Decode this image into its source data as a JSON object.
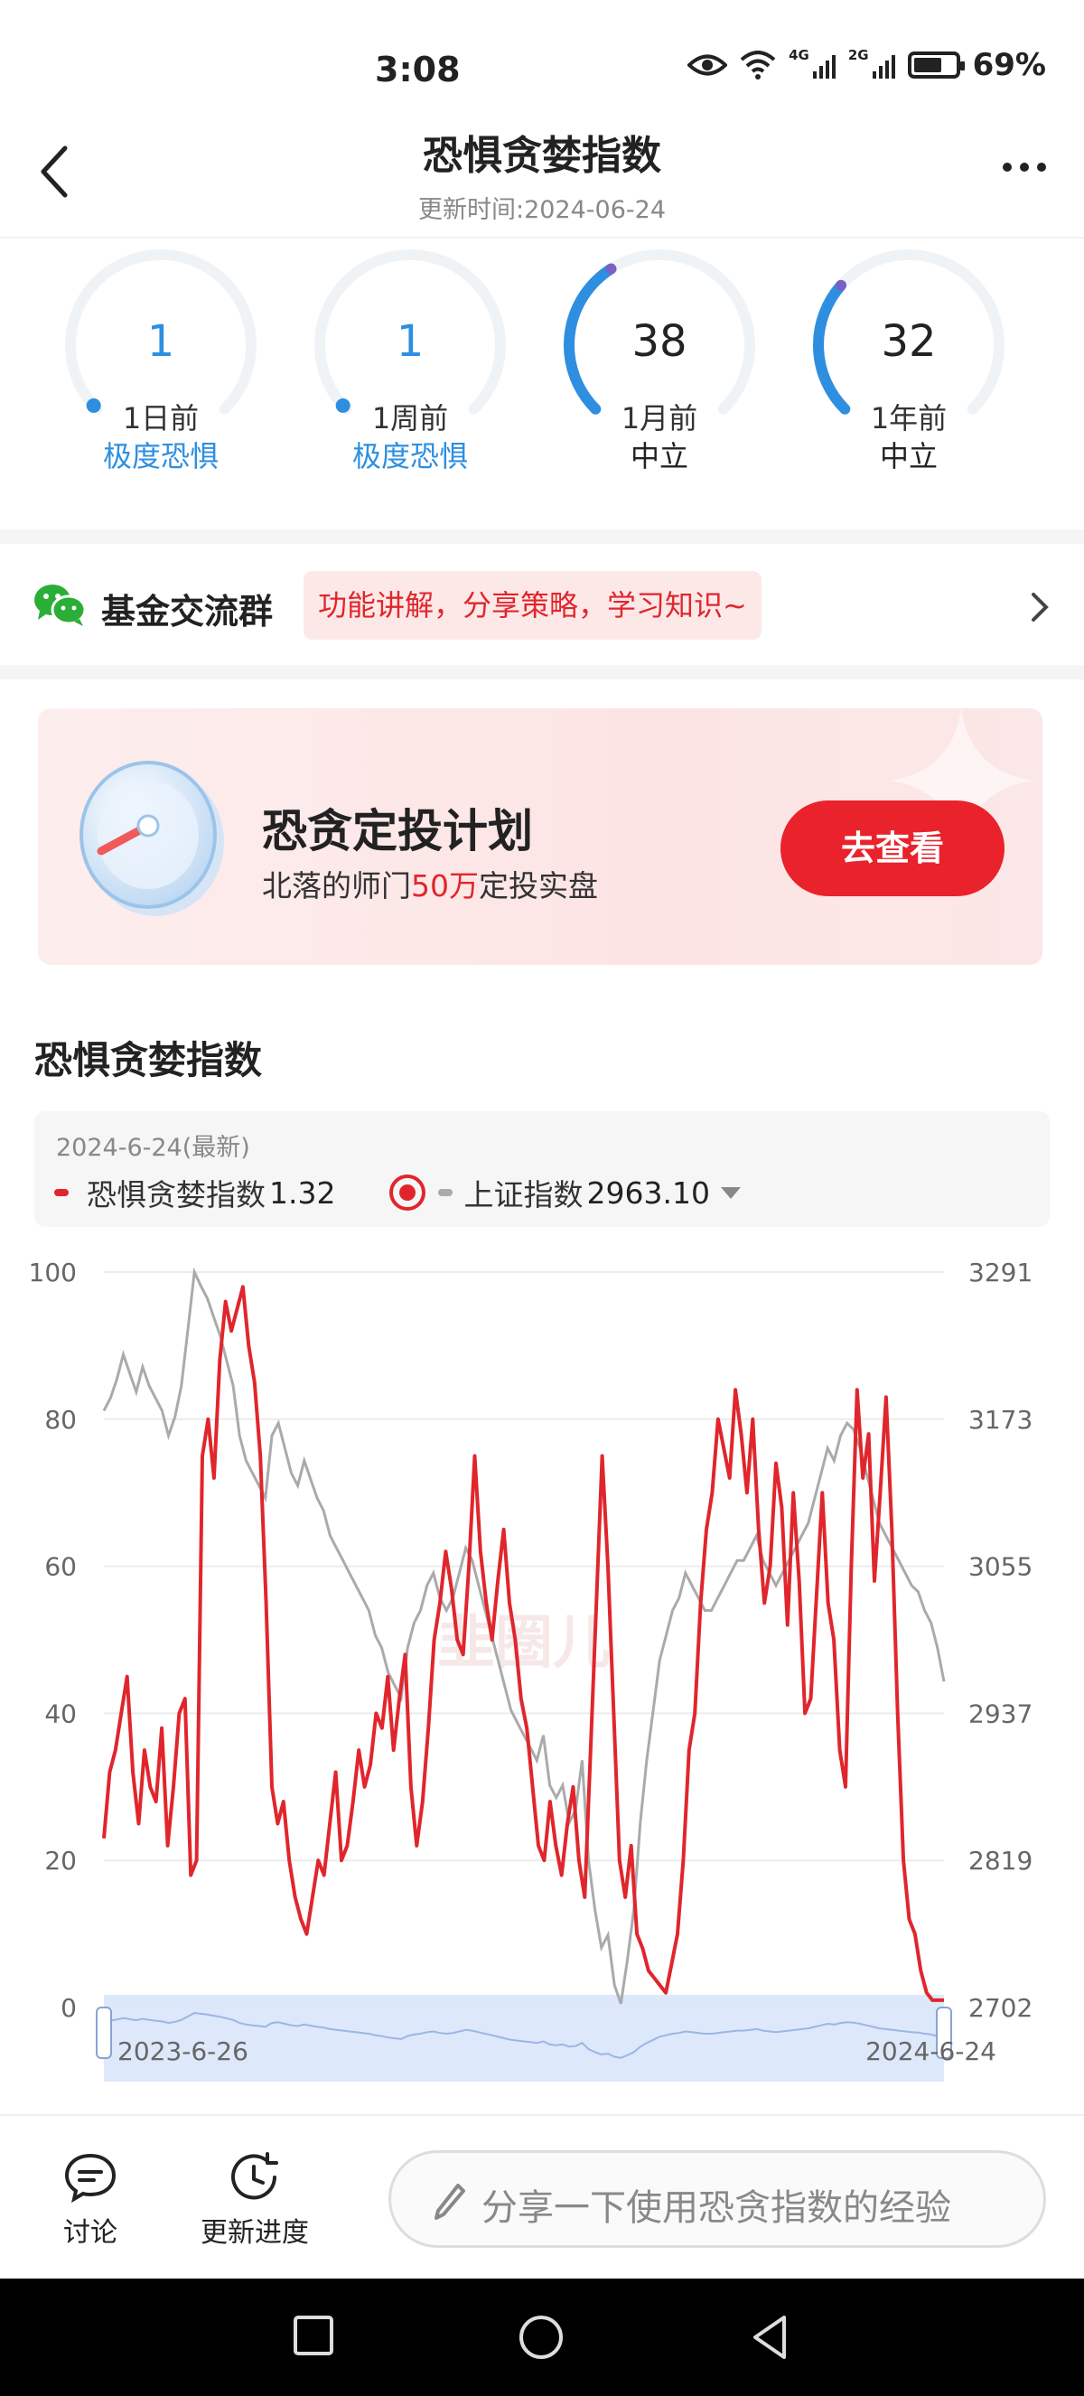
{
  "status_bar": {
    "time": "3:08",
    "net1": "4G",
    "net2": "2G",
    "battery": "69%"
  },
  "header": {
    "title": "恐惧贪婪指数",
    "updated": "更新时间:2024-06-24"
  },
  "gauges": [
    {
      "value": "1",
      "period": "1日前",
      "level": "极度恐惧",
      "level_color": "#2e8fe0",
      "fill": 0.01
    },
    {
      "value": "1",
      "period": "1周前",
      "level": "极度恐惧",
      "level_color": "#2e8fe0",
      "fill": 0.01
    },
    {
      "value": "38",
      "period": "1月前",
      "level": "中立",
      "level_color": "#333333",
      "fill": 0.38
    },
    {
      "value": "32",
      "period": "1年前",
      "level": "中立",
      "level_color": "#333333",
      "fill": 0.32
    }
  ],
  "group": {
    "name": "基金交流群",
    "tag": "功能讲解，分享策略，学习知识~"
  },
  "promo": {
    "title": "恐贪定投计划",
    "sub_prefix": "北落的师门",
    "sub_highlight": "50万",
    "sub_suffix": "定投实盘",
    "button": "去查看"
  },
  "chart_section": {
    "title": "恐惧贪婪指数",
    "legend_date": "2024-6-24(最新)",
    "series1_label": "恐惧贪婪指数",
    "series1_value": "1.32",
    "series2_label": "上证指数",
    "series2_value": "2963.10"
  },
  "chart_data": {
    "type": "line",
    "x_start": "2023-6-26",
    "x_end": "2024-6-24",
    "y_left": {
      "min": 0,
      "max": 100,
      "ticks": [
        "100",
        "80",
        "60",
        "40",
        "20",
        "0"
      ]
    },
    "y_right": {
      "min": 2702,
      "max": 3291,
      "ticks": [
        "3291",
        "3173",
        "3055",
        "2937",
        "2819",
        "2702"
      ]
    },
    "grid": true,
    "series": [
      {
        "name": "恐惧贪婪指数",
        "color": "#e0262c",
        "axis": "left",
        "values": [
          23,
          32,
          35,
          40,
          45,
          32,
          25,
          35,
          30,
          28,
          38,
          22,
          30,
          40,
          42,
          18,
          20,
          75,
          80,
          72,
          88,
          96,
          92,
          95,
          98,
          90,
          85,
          75,
          55,
          30,
          25,
          28,
          20,
          15,
          12,
          10,
          15,
          20,
          18,
          25,
          32,
          20,
          22,
          28,
          35,
          30,
          33,
          40,
          38,
          45,
          35,
          42,
          48,
          30,
          22,
          28,
          38,
          50,
          55,
          62,
          57,
          50,
          48,
          60,
          75,
          62,
          55,
          50,
          58,
          65,
          55,
          50,
          42,
          38,
          30,
          22,
          20,
          28,
          22,
          18,
          25,
          30,
          20,
          15,
          35,
          55,
          75,
          60,
          40,
          20,
          15,
          22,
          10,
          8,
          5,
          4,
          3,
          2,
          6,
          10,
          20,
          35,
          40,
          55,
          65,
          70,
          80,
          76,
          72,
          84,
          78,
          70,
          80,
          65,
          55,
          60,
          74,
          68,
          52,
          70,
          58,
          40,
          42,
          56,
          70,
          55,
          50,
          35,
          30,
          60,
          84,
          72,
          78,
          58,
          70,
          83,
          65,
          40,
          20,
          12,
          10,
          5,
          2,
          1,
          1,
          1
        ]
      },
      {
        "name": "上证指数",
        "color": "#aaaaaa",
        "axis": "right",
        "values": [
          3180,
          3190,
          3205,
          3225,
          3210,
          3195,
          3215,
          3200,
          3190,
          3180,
          3160,
          3175,
          3200,
          3245,
          3291,
          3280,
          3270,
          3255,
          3240,
          3220,
          3200,
          3160,
          3140,
          3130,
          3120,
          3110,
          3160,
          3170,
          3150,
          3130,
          3120,
          3140,
          3125,
          3110,
          3100,
          3080,
          3070,
          3060,
          3050,
          3040,
          3030,
          3020,
          3000,
          2990,
          2970,
          2960,
          2950,
          2990,
          3010,
          3020,
          3040,
          3050,
          3030,
          3020,
          3030,
          3050,
          3070,
          3060,
          3040,
          3020,
          3000,
          2980,
          2960,
          2940,
          2930,
          2920,
          2910,
          2900,
          2920,
          2880,
          2870,
          2880,
          2850,
          2860,
          2900,
          2820,
          2780,
          2750,
          2760,
          2720,
          2705,
          2740,
          2780,
          2850,
          2900,
          2940,
          2980,
          3000,
          3020,
          3030,
          3050,
          3040,
          3030,
          3020,
          3020,
          3030,
          3040,
          3050,
          3060,
          3060,
          3070,
          3080,
          3060,
          3050,
          3040,
          3050,
          3060,
          3070,
          3080,
          3090,
          3110,
          3130,
          3150,
          3140,
          3160,
          3170,
          3165,
          3150,
          3130,
          3110,
          3090,
          3080,
          3070,
          3060,
          3050,
          3040,
          3035,
          3020,
          3010,
          2990,
          2963.1
        ]
      }
    ],
    "watermark": "韭圈儿"
  },
  "bottom_bar": {
    "discuss": "讨论",
    "progress": "更新进度",
    "comment_placeholder": "分享一下使用恐贪指数的经验"
  }
}
